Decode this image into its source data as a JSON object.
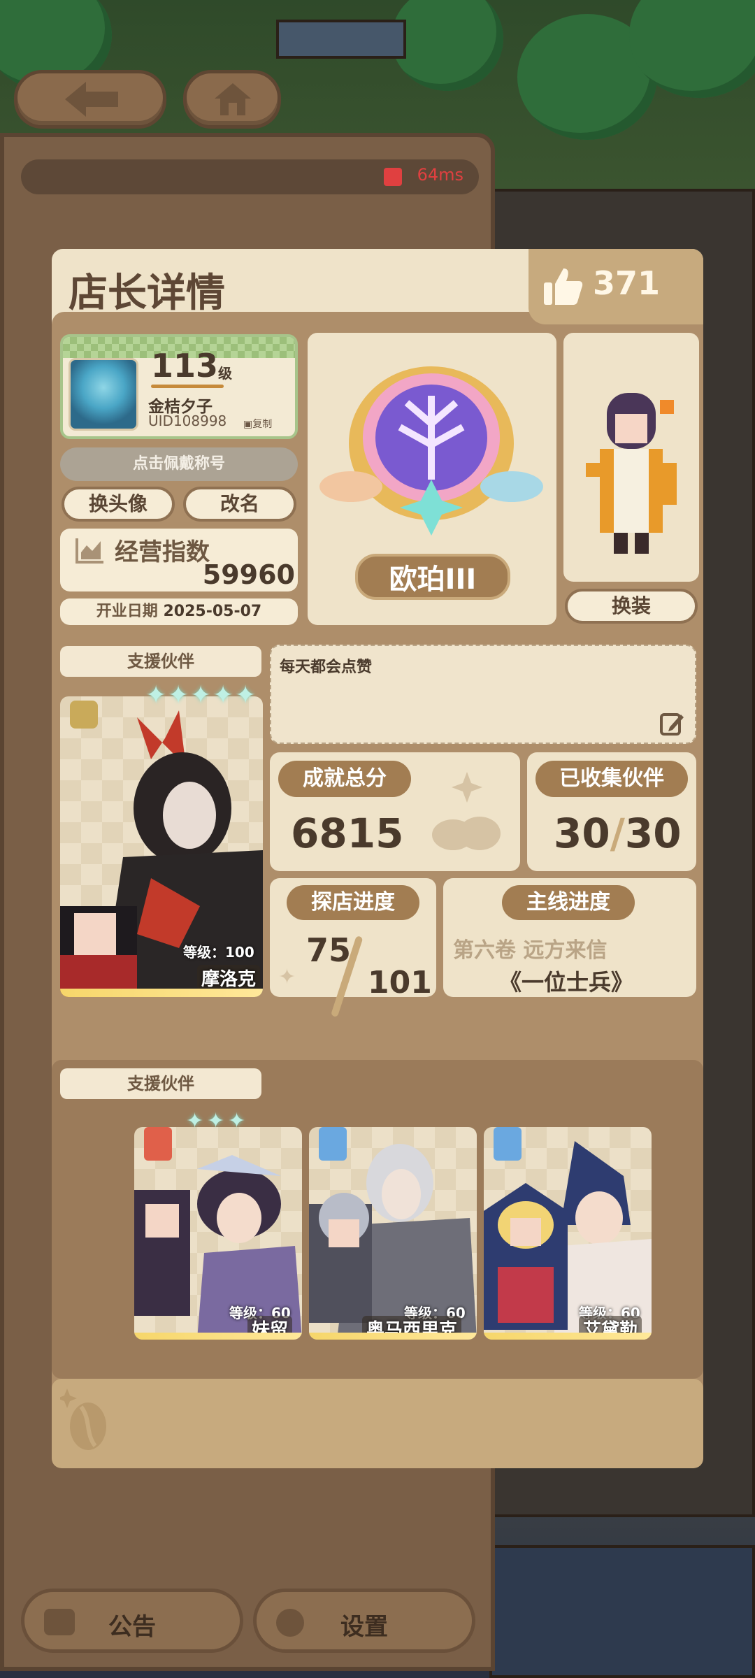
{
  "status": {
    "ping": "64ms"
  },
  "dialog": {
    "title": "店长详情",
    "likes": "371"
  },
  "profile": {
    "level": "113",
    "level_unit": "级",
    "name": "金桔夕子",
    "uid": "UID108998",
    "copy_label": "复制",
    "title_button": "点击佩戴称号",
    "change_avatar": "换头像",
    "rename": "改名",
    "business_label": "经营指数",
    "business_value": "59960",
    "open_date_label": "开业日期",
    "open_date": "2025-05-07"
  },
  "rank": {
    "name": "欧珀III"
  },
  "outfit": {
    "button": "换装"
  },
  "main_partner": {
    "header": "支援伙伴",
    "level_text": "等级：100",
    "name": "摩洛克",
    "stars": 5
  },
  "motto": {
    "text": "每天都会点赞"
  },
  "stats": {
    "achievement_label": "成就总分",
    "achievement_value": "6815",
    "collected_label": "已收集伙伴",
    "collected_value": "30",
    "collected_total": "30",
    "explore_label": "探店进度",
    "explore_value": "75",
    "explore_total": "101",
    "story_label": "主线进度",
    "story_chapter": "第六卷 远方来信",
    "story_title": "《一位士兵》"
  },
  "support_partners": {
    "header": "支援伙伴",
    "items": [
      {
        "name": "妹留",
        "level_text": "等级：60",
        "stars_lit": 3,
        "badge_color": "#e0604a"
      },
      {
        "name": "奥马西里克",
        "level_text": "等级：60",
        "stars_lit": 0,
        "badge_color": "#6aa8e0"
      },
      {
        "name": "艾黛勒",
        "level_text": "等级：60",
        "stars_lit": 0,
        "badge_color": "#6aa8e0"
      }
    ]
  },
  "bottom": {
    "notice": "公告",
    "settings": "设置"
  },
  "colors": {
    "accent": "#a27d52",
    "panel": "#efe3c9",
    "frame": "#ae8e6a",
    "ping": "#e04040"
  }
}
